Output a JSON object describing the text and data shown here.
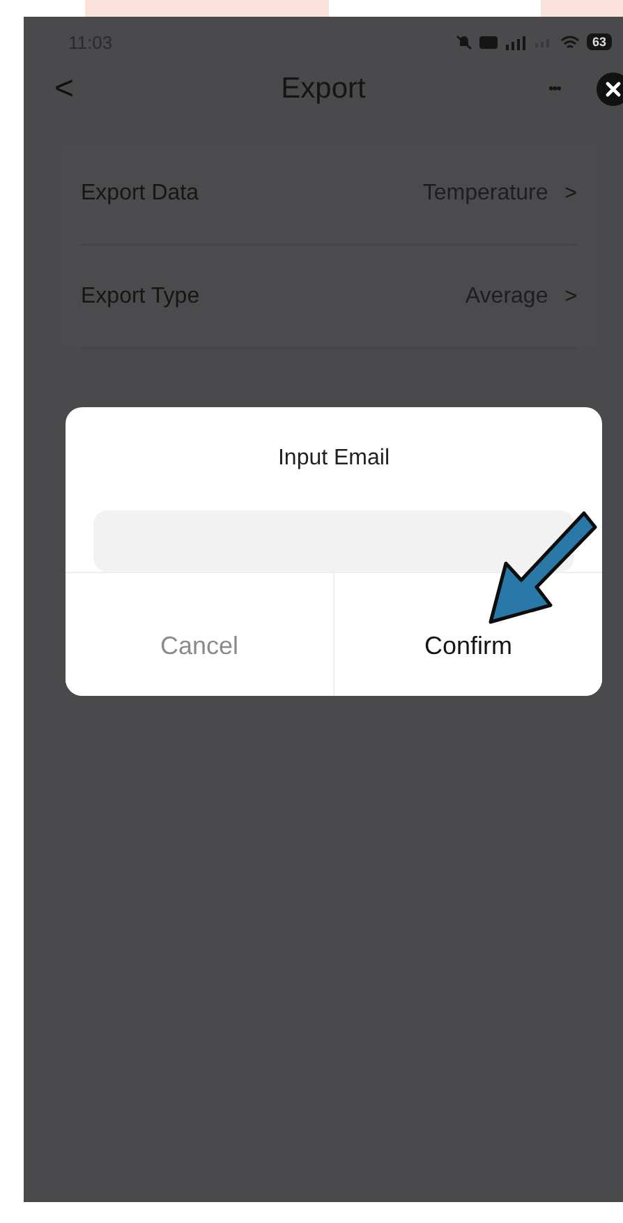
{
  "status_bar": {
    "time": "11:03",
    "battery": "63"
  },
  "nav": {
    "back": "<",
    "title": "Export",
    "more": "•••"
  },
  "settings": [
    {
      "label": "Export Data",
      "value": "Temperature",
      "chevron": ">"
    },
    {
      "label": "Export Type",
      "value": "Average",
      "chevron": ">"
    }
  ],
  "dialog": {
    "title": "Input Email",
    "buttons": [
      {
        "label": "Cancel",
        "kind": "cancel"
      },
      {
        "label": "Confirm",
        "kind": "confirm"
      }
    ]
  }
}
